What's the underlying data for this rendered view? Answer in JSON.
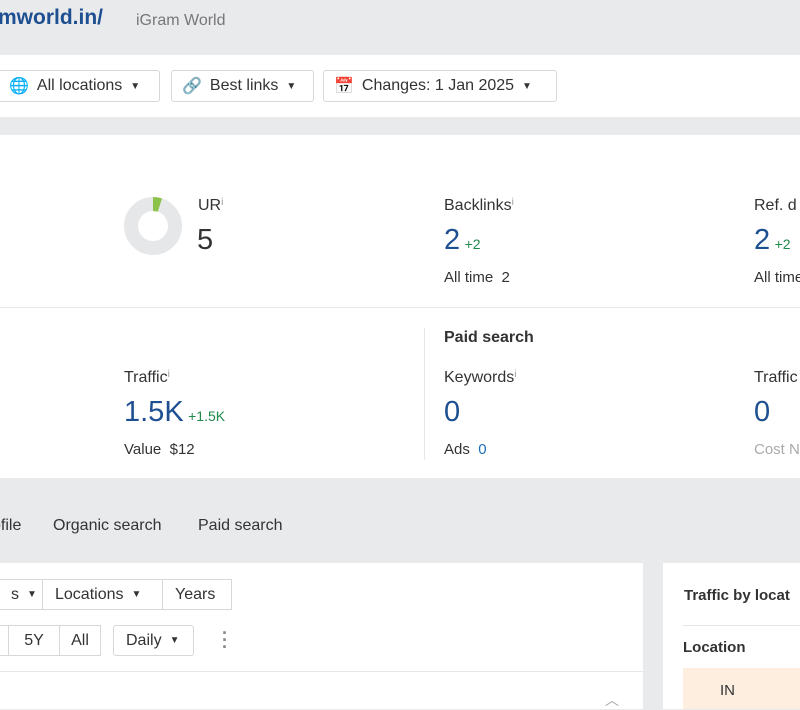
{
  "header": {
    "domain": "mworld.in/",
    "site_name": "iGram World"
  },
  "toolbar": {
    "locations": "All locations",
    "links": "Best links",
    "changes": "Changes: 1 Jan 2025"
  },
  "metrics": {
    "ur": {
      "label": "UR",
      "value": "5",
      "fill_percent": 5
    },
    "backlinks": {
      "label": "Backlinks",
      "value": "2",
      "delta": "+2",
      "sub_label": "All time",
      "sub_value": "2"
    },
    "ref_domains": {
      "label": "Ref. d",
      "value": "2",
      "delta": "+2",
      "sub_label": "All time"
    },
    "traffic": {
      "label": "Traffic",
      "value": "1.5K",
      "delta": "+1.5K",
      "sub_label": "Value",
      "sub_value": "$12"
    },
    "paid_search": {
      "heading": "Paid search",
      "keywords": {
        "label": "Keywords",
        "value": "0",
        "sub_label": "Ads",
        "sub_value": "0"
      },
      "traffic": {
        "label": "Traffic",
        "value": "0",
        "sub_label": "Cost N"
      }
    }
  },
  "info": "i",
  "tabs": [
    "ofile",
    "Organic search",
    "Paid search"
  ],
  "chart_controls": {
    "filter1": "s",
    "locations": "Locations",
    "years": "Years",
    "range_5y": "5Y",
    "range_all": "All",
    "interval": "Daily"
  },
  "right_panel": {
    "title": "Traffic by locat",
    "column": "Location",
    "row1": "IN"
  },
  "colors": {
    "link": "#1d4f91",
    "positive": "#1f8a4c",
    "ur_fill": "#8bc34a",
    "highlight_row": "#fdeee0"
  }
}
